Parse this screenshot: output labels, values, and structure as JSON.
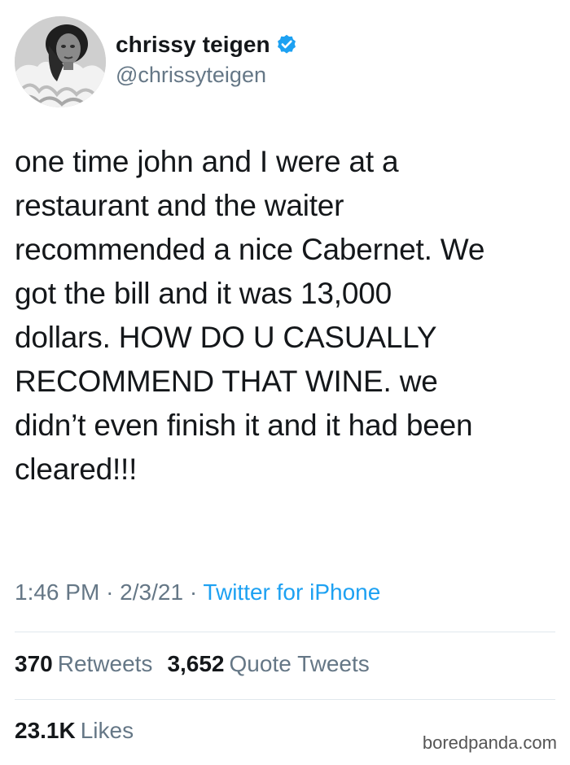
{
  "user": {
    "display_name": "chrissy teigen",
    "handle": "@chrissyteigen",
    "verified": true,
    "verified_icon": "verified-badge-icon",
    "verified_color": "#1da1f2"
  },
  "tweet": {
    "text_lines": [
      "one time john and I were at a",
      "restaurant and the waiter",
      "recommended a nice Cabernet. We",
      "got the bill and it was 13,000",
      "dollars. HOW DO U CASUALLY",
      "RECOMMEND THAT WINE. we",
      "didn’t even finish it and it had been",
      "cleared!!!"
    ],
    "time": "1:46 PM",
    "date": "2/3/21",
    "separator": "·",
    "source": "Twitter for iPhone"
  },
  "stats": {
    "retweets_count": "370",
    "retweets_label": "Retweets",
    "quote_tweets_count": "3,652",
    "quote_tweets_label": "Quote Tweets",
    "likes_count": "23.1K",
    "likes_label": "Likes"
  },
  "watermark": "boredpanda.com",
  "colors": {
    "text": "#14171a",
    "secondary": "#657786",
    "link": "#1da1f2",
    "divider": "#e1e8ed"
  }
}
